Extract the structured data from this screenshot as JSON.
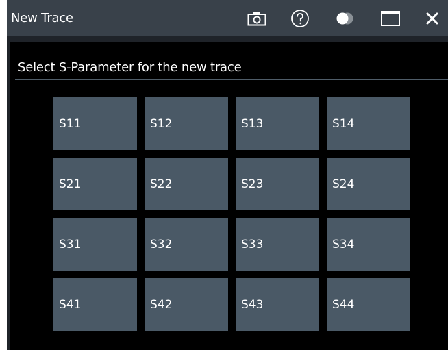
{
  "window": {
    "title": "New Trace"
  },
  "toolbar": {
    "icons": [
      "camera-icon",
      "help-icon",
      "transparency-toggle-icon",
      "maximize-icon",
      "close-icon"
    ]
  },
  "panel": {
    "header": "Select S-Parameter for the new trace"
  },
  "s_parameters": [
    [
      "S11",
      "S12",
      "S13",
      "S14"
    ],
    [
      "S21",
      "S22",
      "S23",
      "S24"
    ],
    [
      "S31",
      "S32",
      "S33",
      "S34"
    ],
    [
      "S41",
      "S42",
      "S43",
      "S44"
    ]
  ],
  "colors": {
    "titlebar": "#39414a",
    "dialog_bg": "#1f2329",
    "panel_bg": "#000000",
    "button_bg": "#4a5966",
    "rule": "#4f5d69",
    "text": "#ffffff"
  }
}
